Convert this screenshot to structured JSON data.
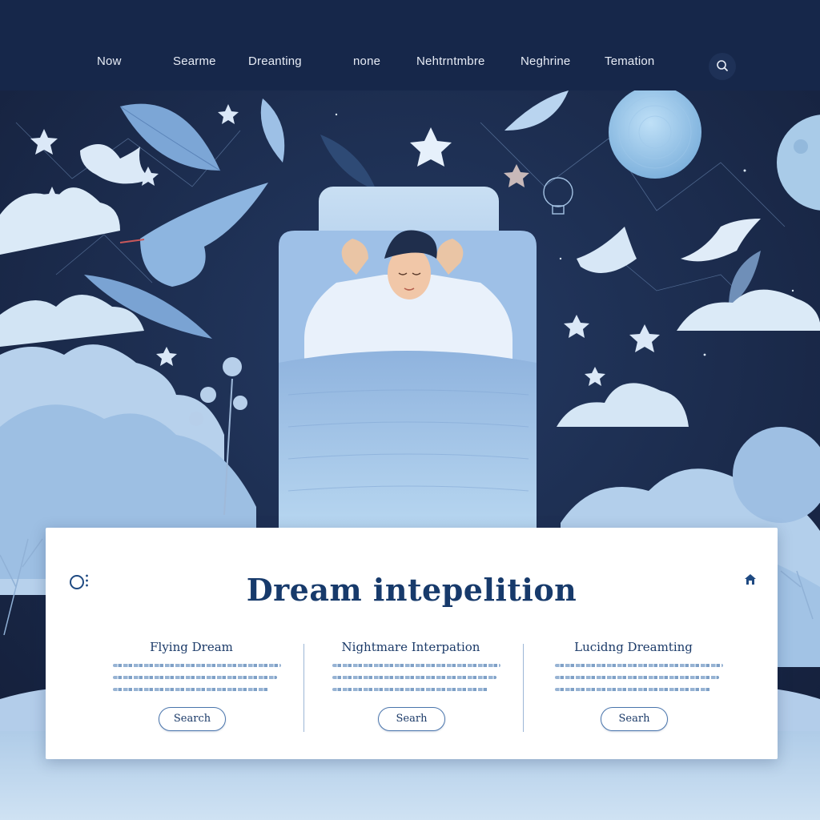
{
  "nav": {
    "items": [
      "Now",
      "Searme",
      "Dreanting",
      "none",
      "Nehtrntmbre",
      "Neghrine",
      "Temation"
    ],
    "search_icon": "search-icon"
  },
  "card": {
    "title": "Dream intepelition",
    "left_icon": "circle-outline-icon",
    "right_icon": "home-icon",
    "columns": [
      {
        "title": "Flying Dream",
        "button": "Search"
      },
      {
        "title": "Nightmare Interpation",
        "button": "Searh"
      },
      {
        "title": "Lucidng Dreamting",
        "button": "Searh"
      }
    ]
  },
  "colors": {
    "nav_bg": "#16274a",
    "night_sky": "#1c2b4a",
    "accent": "#173a6b",
    "soft_blue": "#9cc3e6"
  }
}
